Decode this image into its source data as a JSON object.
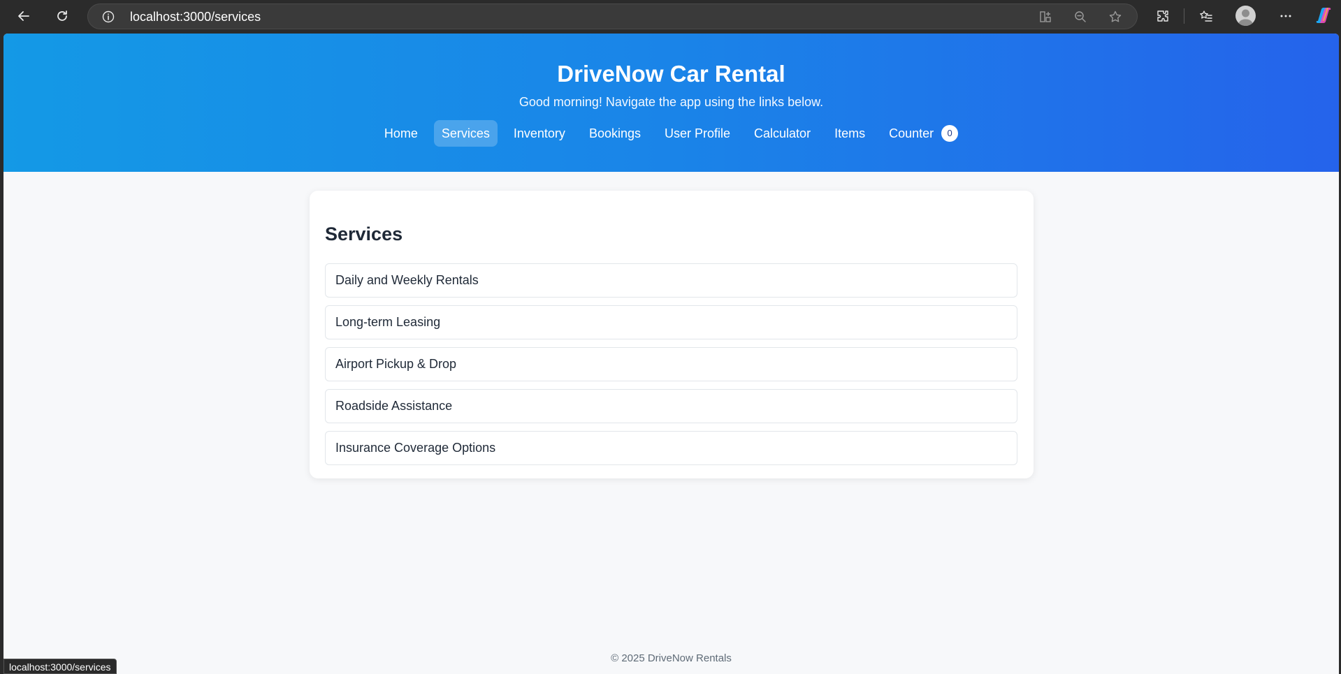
{
  "browser": {
    "url": "localhost:3000/services",
    "status_url": "localhost:3000/services"
  },
  "header": {
    "title": "DriveNow Car Rental",
    "greeting": "Good morning! Navigate the app using the links below."
  },
  "nav": {
    "items": [
      {
        "label": "Home"
      },
      {
        "label": "Services",
        "active": true
      },
      {
        "label": "Inventory"
      },
      {
        "label": "Bookings"
      },
      {
        "label": "User Profile"
      },
      {
        "label": "Calculator"
      },
      {
        "label": "Items"
      },
      {
        "label": "Counter",
        "badge": "0"
      }
    ]
  },
  "main": {
    "heading": "Services",
    "services": [
      "Daily and Weekly Rentals",
      "Long-term Leasing",
      "Airport Pickup & Drop",
      "Roadside Assistance",
      "Insurance Coverage Options"
    ]
  },
  "footer": {
    "text": "© 2025 DriveNow Rentals"
  },
  "colors": {
    "header_gradient_start": "#1499e6",
    "header_gradient_end": "#2563eb",
    "page_background": "#f7f8fa",
    "chrome_background": "#2b2b2b"
  }
}
